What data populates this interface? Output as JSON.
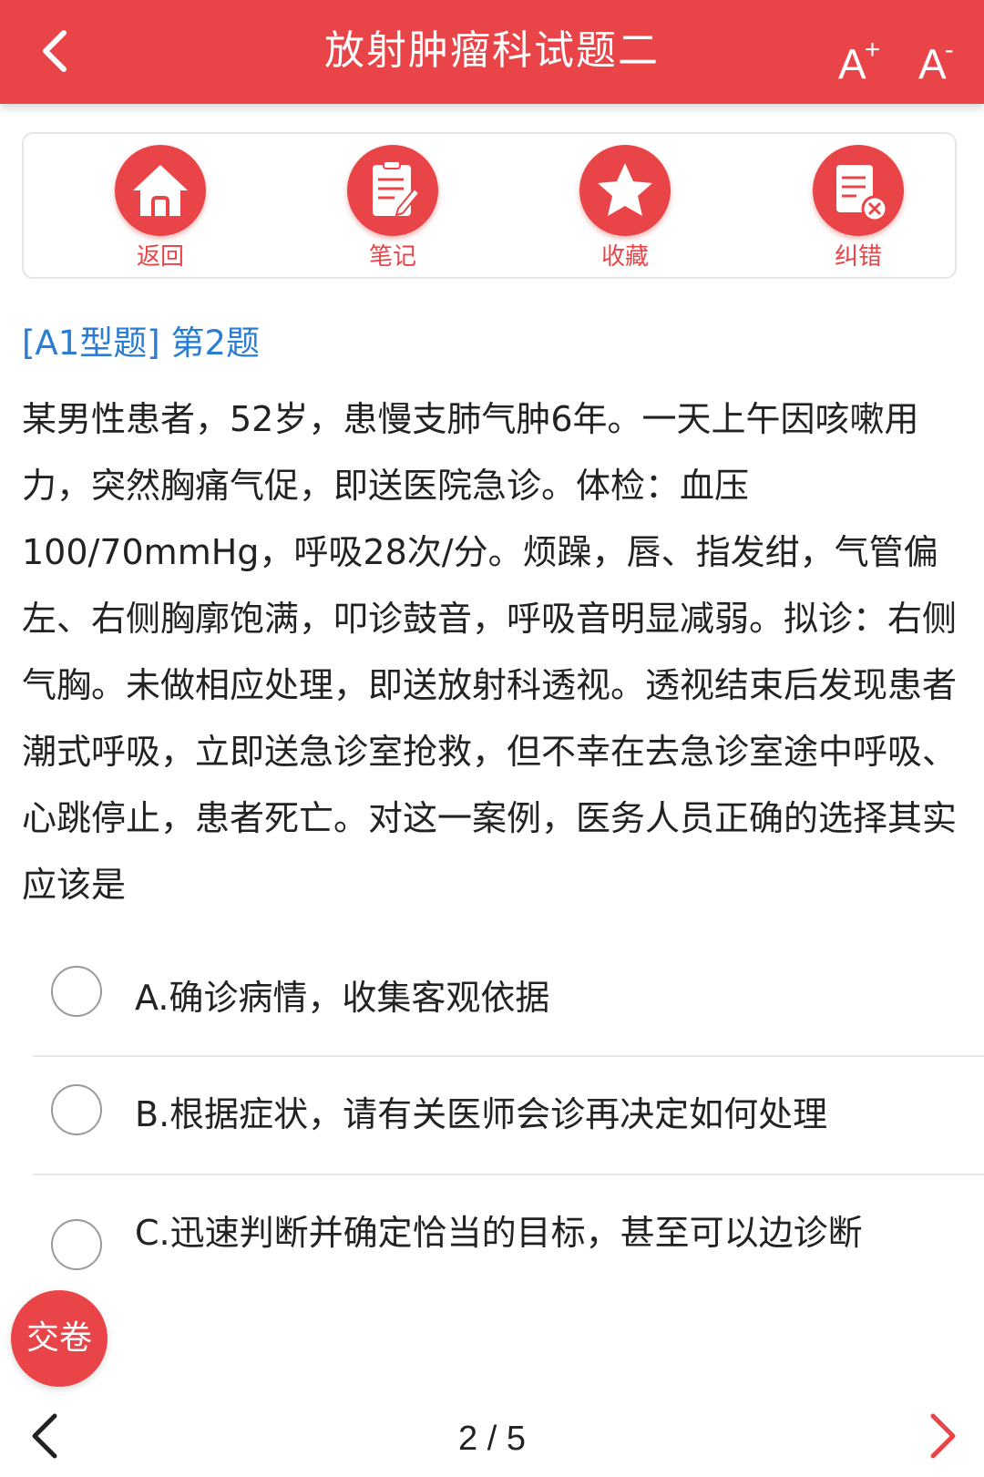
{
  "header": {
    "title": "放射肿瘤科试题二",
    "font_increase_label": "A",
    "font_increase_sup": "+",
    "font_decrease_label": "A",
    "font_decrease_sup": "-"
  },
  "actions": [
    {
      "label": "返回",
      "icon": "home-icon"
    },
    {
      "label": "笔记",
      "icon": "notepad-icon"
    },
    {
      "label": "收藏",
      "icon": "star-icon"
    },
    {
      "label": "纠错",
      "icon": "report-error-icon"
    }
  ],
  "question": {
    "meta": "[A1型题] 第2题",
    "text": "某男性患者，52岁，患慢支肺气肿6年。一天上午因咳嗽用力，突然胸痛气促，即送医院急诊。体检：血压100/70mmHg，呼吸28次/分。烦躁，唇、指发绀，气管偏左、右侧胸廓饱满，叩诊鼓音，呼吸音明显减弱。拟诊：右侧气胸。未做相应处理，即送放射科透视。透视结束后发现患者潮式呼吸，立即送急诊室抢救，但不幸在去急诊室途中呼吸、心跳停止，患者死亡。对这一案例，医务人员正确的选择其实应该是"
  },
  "options": [
    {
      "text": "A.确诊病情，收集客观依据"
    },
    {
      "text": "B.根据症状，请有关医师会诊再决定如何处理"
    },
    {
      "text": "C.迅速判断并确定恰当的目标，甚至可以边诊断"
    }
  ],
  "submit_label": "交卷",
  "pager": "2 / 5",
  "colors": {
    "accent": "#e94448",
    "link": "#2a7cd4"
  }
}
